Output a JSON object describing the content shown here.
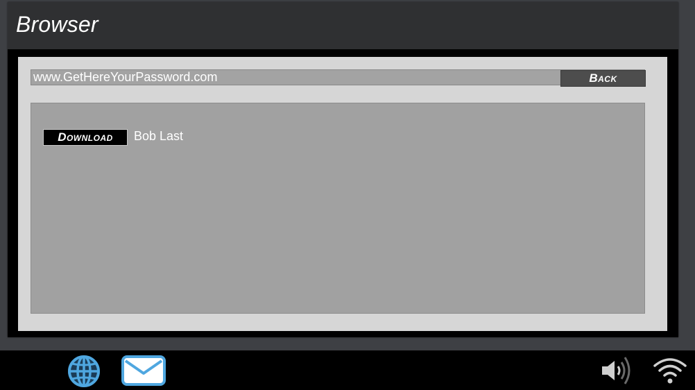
{
  "window": {
    "title": "Browser"
  },
  "browser": {
    "address": "www.GetHereYourPassword.com",
    "back_label": "Back"
  },
  "page": {
    "download_label": "Download",
    "file_name": "Bob Last"
  },
  "taskbar": {
    "apps": [
      {
        "name": "globe-icon"
      },
      {
        "name": "mail-icon"
      }
    ],
    "tray": [
      {
        "name": "volume-icon"
      },
      {
        "name": "wifi-icon"
      }
    ]
  },
  "colors": {
    "accent": "#4fa7e0",
    "window_bg": "#2f3032",
    "content_bg": "#d6d6d6",
    "page_bg": "#a1a1a1"
  }
}
